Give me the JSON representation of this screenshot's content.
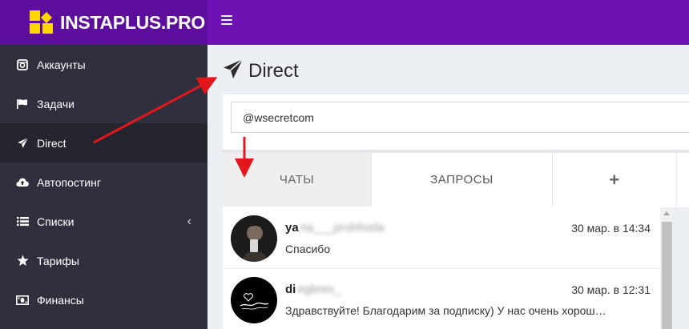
{
  "brand": {
    "name": "INSTAPLUS.PRO"
  },
  "colors": {
    "topbar": "#6d11b3",
    "sidebar": "#2f2f3e",
    "brand_logo": "#ffd500",
    "annotation_arrow": "#e3171b"
  },
  "sidebar": {
    "items": [
      {
        "label": "Аккаунты",
        "icon": "instagram-icon"
      },
      {
        "label": "Задачи",
        "icon": "flag-icon"
      },
      {
        "label": "Direct",
        "icon": "paper-plane-icon",
        "active": true
      },
      {
        "label": "Автопостинг",
        "icon": "cloud-upload-icon"
      },
      {
        "label": "Списки",
        "icon": "list-icon",
        "chevron": "‹"
      },
      {
        "label": "Тарифы",
        "icon": "star-icon"
      },
      {
        "label": "Финансы",
        "icon": "money-icon"
      }
    ]
  },
  "page": {
    "title": "Direct"
  },
  "account": {
    "value": "@wsecretcom"
  },
  "tabs": [
    {
      "label": "ЧАТЫ",
      "active": true
    },
    {
      "label": "ЗАПРОСЫ"
    },
    {
      "label": "+"
    }
  ],
  "chats": [
    {
      "name": "ya",
      "name_blurred": "na___prohhoda",
      "time": "30 мар. в 14:34",
      "message": "Спасибо"
    },
    {
      "name": "di",
      "name_blurred": "egbres_",
      "time": "30 мар. в 12:31",
      "message": "Здравствуйте! Благодарим за подписку) У нас очень хорош…"
    }
  ]
}
